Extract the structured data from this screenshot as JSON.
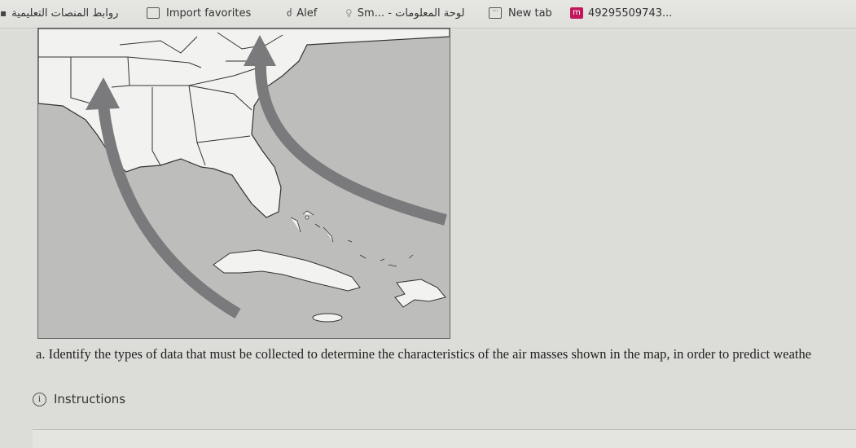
{
  "bookmarks": [
    {
      "label": "روابط المنصات التعليمية",
      "icon": "arabic-bookmark-icon"
    },
    {
      "label": "Import favorites",
      "icon": "import-icon"
    },
    {
      "label": "Alef",
      "icon": "alef-icon"
    },
    {
      "label": "Sm... - لوحة المعلومات",
      "icon": "person-icon"
    },
    {
      "label": "New tab",
      "icon": "newtab-icon"
    },
    {
      "label": "49295509743...",
      "icon": "m-icon"
    }
  ],
  "question": {
    "text": "a. Identify the types of data that must be collected to determine the characteristics of the air masses shown in the map, in order to predict weathe"
  },
  "instructions": {
    "label": "Instructions",
    "icon": "info-icon"
  },
  "colors": {
    "map_sea": "#bdbdbb",
    "map_land": "#f2f2f0",
    "arrow": "#7a7a7c",
    "page_bg": "#dcdcd8"
  }
}
